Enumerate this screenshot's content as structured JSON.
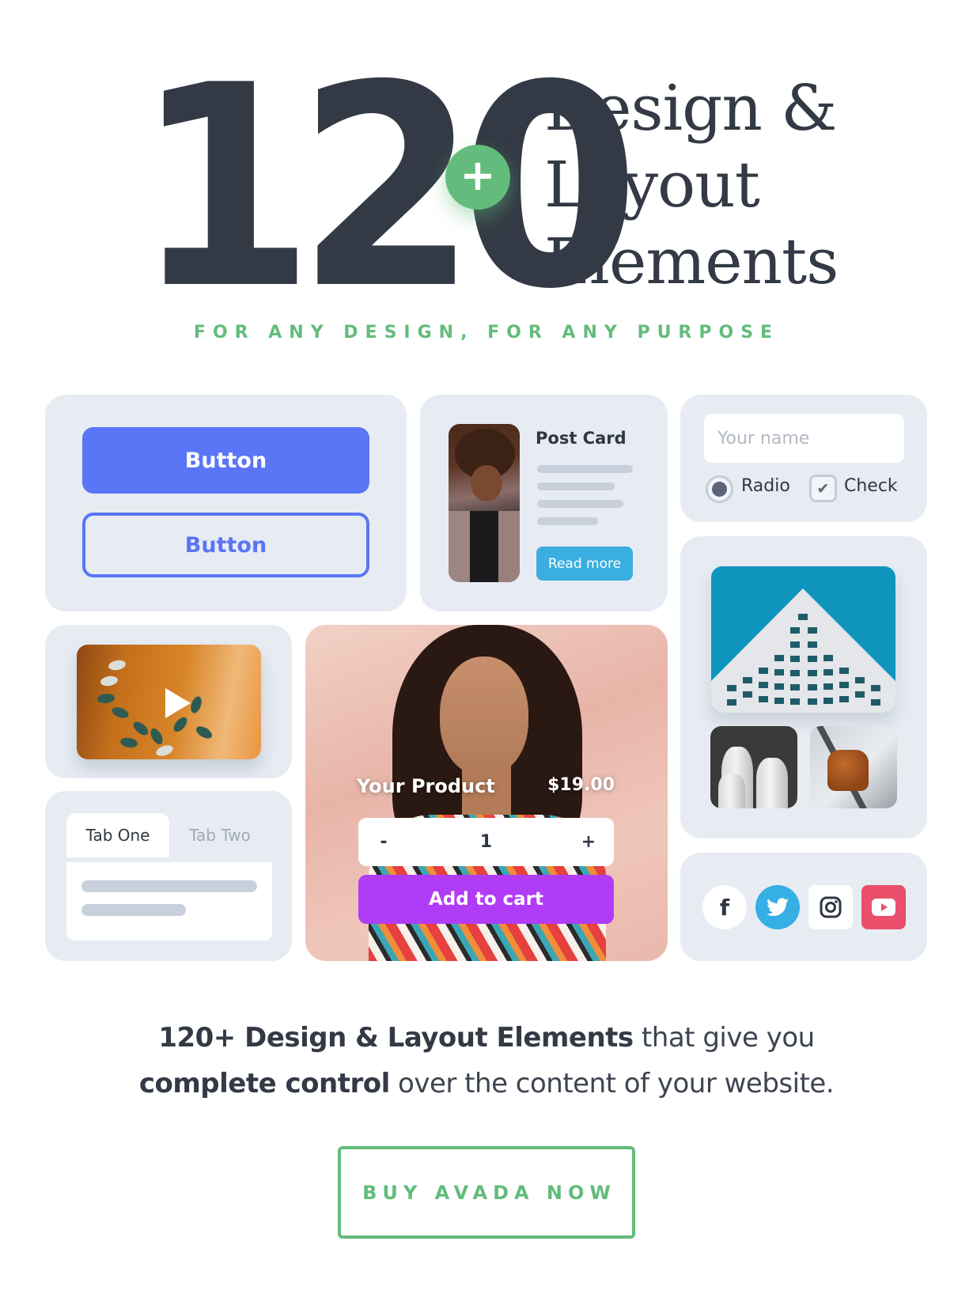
{
  "hero": {
    "number": "120",
    "plus_symbol": "+",
    "words": [
      "Design &",
      "Layout",
      "Elements"
    ],
    "tagline": "FOR ANY DESIGN, FOR ANY PURPOSE"
  },
  "buttons_card": {
    "primary_label": "Button",
    "outline_label": "Button"
  },
  "post_card": {
    "title": "Post Card",
    "read_more_label": "Read more",
    "image": "woman-with-laptop-photo"
  },
  "form_card": {
    "name_placeholder": "Your name",
    "name_value": "",
    "radio_label": "Radio",
    "radio_checked": true,
    "check_label": "Check",
    "check_checked": true,
    "check_glyph": "✔"
  },
  "gallery_card": {
    "images": [
      "building-facade-photo",
      "white-vases-photo",
      "wooden-chair-photo"
    ]
  },
  "video_card": {
    "thumbnail": "plant-shadow-photo",
    "icon": "play-icon"
  },
  "tabs_card": {
    "tabs": [
      {
        "label": "Tab One",
        "active": true
      },
      {
        "label": "Tab Two",
        "active": false
      }
    ]
  },
  "product_card": {
    "name": "Your Product",
    "price": "$19.00",
    "quantity": "1",
    "minus_label": "-",
    "plus_label": "+",
    "add_to_cart_label": "Add to cart",
    "image": "woman-portrait-photo"
  },
  "social_card": {
    "icons": [
      {
        "name": "facebook-icon",
        "glyph": "f"
      },
      {
        "name": "twitter-icon"
      },
      {
        "name": "instagram-icon"
      },
      {
        "name": "youtube-icon"
      }
    ]
  },
  "lead": {
    "bold_1": "120+ Design & Layout Elements",
    "text_1": " that give you",
    "bold_2": "complete control",
    "text_2": " over the content of your website."
  },
  "cta": {
    "label": "BUY AVADA NOW"
  },
  "colors": {
    "text_dark": "#333a45",
    "green_accent": "#63bc7b",
    "card_bg": "#e7ecf3",
    "primary_blue": "#5a75f5",
    "read_more_blue": "#3aaee0",
    "add_to_cart_purple": "#b13cf7",
    "twitter_blue": "#35afe4",
    "youtube_red": "#ea4f6b"
  }
}
